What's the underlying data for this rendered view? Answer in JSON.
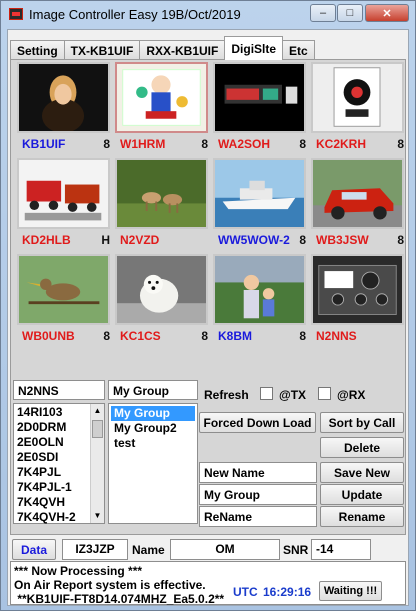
{
  "window": {
    "title": "Image Controller Easy 19B/Oct/2019"
  },
  "tabs": [
    {
      "label": "Setting"
    },
    {
      "label": "TX-KB1UIF"
    },
    {
      "label": "RXX-KB1UIF"
    },
    {
      "label": "DigiSlte"
    },
    {
      "label": "Etc"
    }
  ],
  "active_tab": "DigiSlte",
  "stations": [
    {
      "call": "KB1UIF",
      "mode": "8",
      "color": "#1a1adc",
      "thumb": "portrait-woman"
    },
    {
      "call": "W1HRM",
      "mode": "8",
      "color": "#e01b1b",
      "thumb": "cartoon-girl"
    },
    {
      "call": "WA2SOH",
      "mode": "8",
      "color": "#e01b1b",
      "thumb": "dark-screen"
    },
    {
      "call": "KC2KRH",
      "mode": "8",
      "color": "#e01b1b",
      "thumb": "logo-badge"
    },
    {
      "call": "KD2HLB",
      "mode": "H",
      "color": "#e01b1b",
      "thumb": "red-trucks"
    },
    {
      "call": "N2VZD",
      "mode": "",
      "color": "#e01b1b",
      "thumb": "deer"
    },
    {
      "call": "WW5WOW-2",
      "mode": "8",
      "color": "#1a1adc",
      "thumb": "yacht"
    },
    {
      "call": "WB3JSW",
      "mode": "8",
      "color": "#e01b1b",
      "thumb": "red-car"
    },
    {
      "call": "WB0UNB",
      "mode": "8",
      "color": "#e01b1b",
      "thumb": "bird"
    },
    {
      "call": "KC1CS",
      "mode": "8",
      "color": "#e01b1b",
      "thumb": "bear-cub"
    },
    {
      "call": "K8BM",
      "mode": "8",
      "color": "#1a1adc",
      "thumb": "woman-child"
    },
    {
      "call": "N2NNS",
      "mode": "",
      "color": "#e01b1b",
      "thumb": "radio-gear"
    }
  ],
  "station_field": "N2NNS",
  "group_field": "My Group",
  "call_list": [
    "14RI103",
    "2D0DRM",
    "2E0OLN",
    "2E0SDI",
    "7K4PJL",
    "7K4PJL-1",
    "7K4QVH",
    "7K4QVH-2"
  ],
  "group_list": [
    {
      "label": "My Group",
      "selected": true
    },
    {
      "label": "My Group2",
      "selected": false
    },
    {
      "label": "test",
      "selected": false
    }
  ],
  "refresh": {
    "label": "Refresh",
    "tx_label": "@TX",
    "rx_label": "@RX"
  },
  "buttons": {
    "forced_download": "Forced Down Load",
    "sort_by_call": "Sort by Call",
    "delete": "Delete",
    "save_new": "Save New",
    "update": "Update",
    "rename": "Rename"
  },
  "fields": {
    "new_name": "New Name",
    "my_group": "My Group",
    "rename": "ReName"
  },
  "status": {
    "data_button": "Data",
    "callsign": "IZ3JZP",
    "name_label": "Name",
    "name_value": "OM",
    "snr_label": "SNR",
    "snr_value": "-14"
  },
  "log": {
    "line1": "*** Now Processing ***",
    "line2": "On Air Report system is effective.",
    "line3": " **KB1UIF-FT8D14.074MHZ_Ea5.0.2**",
    "utc_label": "UTC",
    "time": "16:29:16",
    "waiting": "Waiting !!!"
  },
  "icons": {
    "minimize": "minimize-icon",
    "maximize": "maximize-icon",
    "close": "close-icon",
    "app": "app-icon"
  }
}
